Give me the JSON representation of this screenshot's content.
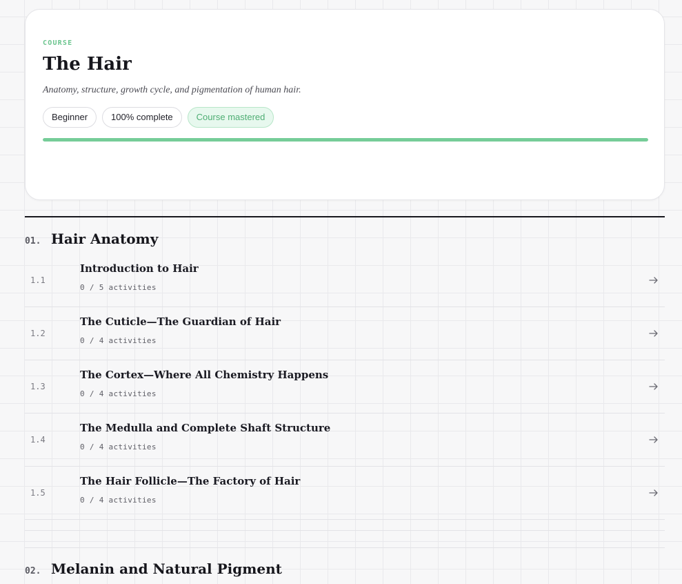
{
  "course": {
    "eyebrow": "COURSE",
    "title": "The Hair",
    "subtitle": "Anatomy, structure, growth cycle, and pigmentation of human hair.",
    "level": "Beginner",
    "completion": "100% complete",
    "status": "Course mastered",
    "progress": 1.0
  },
  "sections": [
    {
      "number": "01.",
      "title": "Hair Anatomy",
      "lessons": [
        {
          "number": "1.1",
          "title": "Introduction to Hair",
          "meta": "0 / 5 activities",
          "icon": "arrow-right-icon"
        },
        {
          "number": "1.2",
          "title": "The Cuticle—The Guardian of Hair",
          "meta": "0 / 4 activities",
          "icon": "arrow-right-icon"
        },
        {
          "number": "1.3",
          "title": "The Cortex—Where All Chemistry Happens",
          "meta": "0 / 4 activities",
          "icon": "arrow-right-icon"
        },
        {
          "number": "1.4",
          "title": "The Medulla and Complete Shaft Structure",
          "meta": "0 / 4 activities",
          "icon": "arrow-right-icon"
        },
        {
          "number": "1.5",
          "title": "The Hair Follicle—The Factory of Hair",
          "meta": "0 / 4 activities",
          "icon": "arrow-right-icon"
        }
      ]
    },
    {
      "number": "02.",
      "title": "Melanin and Natural Pigment",
      "lessons": []
    }
  ],
  "colors": {
    "accent": "#76cd98",
    "ink": "#16161c"
  }
}
